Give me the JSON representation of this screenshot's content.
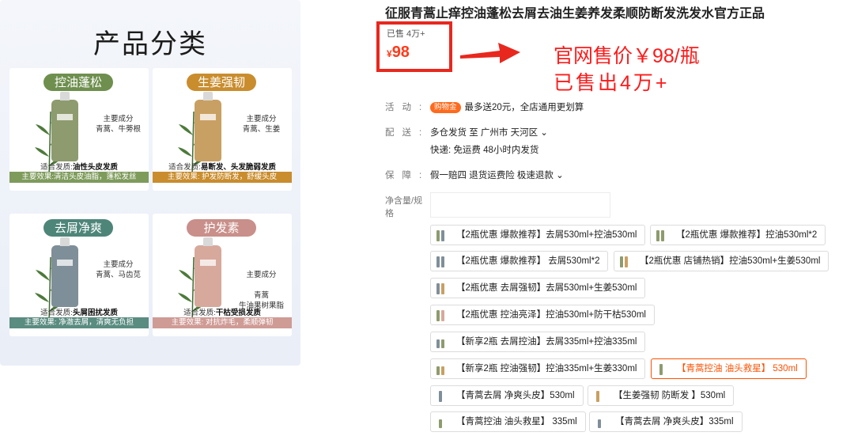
{
  "categories": {
    "title": "产品分类",
    "cards": [
      {
        "name": "控油蓬松",
        "ing_title": "主要成分",
        "ing": "青蒿、牛蒡根",
        "suit_prefix": "适合发质:",
        "suit": "油性头皮发质",
        "effect": "主要效果:清洁头皮油脂，蓬松发丝",
        "pill_color": "#6e8f4e",
        "bottle_color": "#8e9b6e",
        "eff_color": "#7e9b5c"
      },
      {
        "name": "生姜强韧",
        "ing_title": "主要成分",
        "ing": "青蒿、生姜",
        "suit_prefix": "适合发质:",
        "suit": "易断发、头发脆弱发质",
        "effect": "主要效果: 护发防断发，舒缓头皮",
        "pill_color": "#c98d2e",
        "bottle_color": "#c9a063",
        "eff_color": "#c98d2e"
      },
      {
        "name": "去屑净爽",
        "ing_title": "主要成分",
        "ing": "青蒿、马齿苋",
        "suit_prefix": "适合发质:",
        "suit": "头屑困扰发质",
        "effect": "主要效果: 净澈去屑，清爽无负担",
        "pill_color": "#4e8579",
        "bottle_color": "#7f8f99",
        "eff_color": "#5a8c80"
      },
      {
        "name": "护发素",
        "ing_title": "主要成分",
        "ing": "青蒿\n牛油果树果脂",
        "suit_prefix": "适合发质:",
        "suit": "干枯受损发质",
        "effect": "主要效果: 对抗炸毛，柔顺弹韧",
        "pill_color": "#c98f8a",
        "bottle_color": "#d7a99c",
        "eff_color": "#cf9b95"
      }
    ]
  },
  "product": {
    "title": "征服青蒿止痒控油蓬松去屑去油生姜养发柔顺防断发洗发水官方正品",
    "sold": "已售 4万+",
    "price_currency": "¥",
    "price": "98",
    "annotation_line1": "官网售价￥98/瓶",
    "annotation_line2": "已售出4万+",
    "activity_label": "活动:",
    "activity_badge": "购物金",
    "activity_text": "最多送20元，全店通用更划算",
    "delivery_label": "配送:",
    "delivery_line1": "多仓发货  至  广州市 天河区 ⌄",
    "delivery_line2": "快递: 免运费  48小时内发货",
    "guarantee_label": "保障:",
    "guarantee_text": "假一赔四 退货运费险 极速退款 ⌄",
    "spec_label": "净含量/规格",
    "options": [
      {
        "label": "【2瓶优惠 爆款推荐】去屑530ml+控油530ml",
        "selected": false
      },
      {
        "label": "【2瓶优惠 爆款推荐】控油530ml*2",
        "selected": false
      },
      {
        "label": "【2瓶优惠 爆款推荐】 去屑530ml*2",
        "selected": false
      },
      {
        "label": "【2瓶优惠 店铺热销】控油530ml+生姜530ml",
        "selected": false
      },
      {
        "label": "【2瓶优惠 去屑强韧】去屑530ml+生姜530ml",
        "selected": false
      },
      {
        "label": "【2瓶优惠 控油亮泽】控油530ml+防干枯530ml",
        "selected": false
      },
      {
        "label": "【新享2瓶 去屑控油】去屑335ml+控油335ml",
        "selected": false
      },
      {
        "label": "【新享2瓶 控油强韧】控油335ml+生姜330ml",
        "selected": false
      },
      {
        "label": "【青蒿控油 油头救星】 530ml",
        "selected": true
      },
      {
        "label": "【青蒿去屑 净爽头皮】530ml",
        "selected": false
      },
      {
        "label": "【生姜强韧 防断发 】530ml",
        "selected": false
      },
      {
        "label": "【青蒿控油 油头救星】 335ml",
        "selected": false
      },
      {
        "label": "【青蒿去屑 净爽头皮】335ml",
        "selected": false
      }
    ]
  }
}
